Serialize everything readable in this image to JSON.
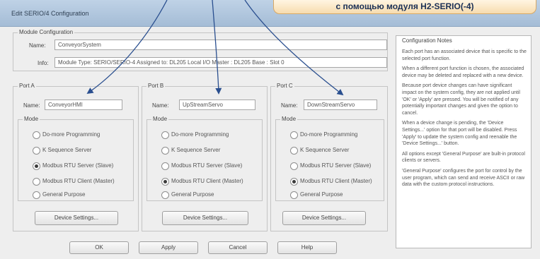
{
  "window": {
    "title": "Edit SERIO/4 Configuration"
  },
  "banner": "с помощью модуля H2-SERIO(-4)",
  "module": {
    "group_label": "Module Configuration",
    "name_label": "Name:",
    "name_value": "ConveyorSystem",
    "info_label": "Info:",
    "info_value": "Module Type: SERIO/SERIO-4   Assigned to: DL205 Local I/O Master : DL205 Base : Slot 0"
  },
  "ports": [
    {
      "title": "Port A",
      "name_label": "Name:",
      "name_value": "ConveyorHMI",
      "mode_label": "Mode",
      "options": [
        "Do-more Programming",
        "K Sequence Server",
        "Modbus RTU Server (Slave)",
        "Modbus RTU Client (Master)",
        "General Purpose"
      ],
      "selected": 2,
      "settings_button": "Device Settings..."
    },
    {
      "title": "Port B",
      "name_label": "Name:",
      "name_value": "UpStreamServo",
      "mode_label": "Mode",
      "options": [
        "Do-more Programming",
        "K Sequence Server",
        "Modbus RTU Server (Slave)",
        "Modbus RTU Client (Master)",
        "General Purpose"
      ],
      "selected": 3,
      "settings_button": "Device Settings..."
    },
    {
      "title": "Port C",
      "name_label": "Name:",
      "name_value": "DownStreamServo",
      "mode_label": "Mode",
      "options": [
        "Do-more Programming",
        "K Sequence Server",
        "Modbus RTU Server (Slave)",
        "Modbus RTU Client (Master)",
        "General Purpose"
      ],
      "selected": 3,
      "settings_button": "Device Settings..."
    }
  ],
  "buttons": {
    "ok": "OK",
    "apply": "Apply",
    "cancel": "Cancel",
    "help": "Help"
  },
  "notes": {
    "title": "Configuration Notes",
    "paragraphs": [
      "Each port has an associated device that is specific to the selected port function.",
      "When a different port function is chosen, the associated device may be deleted and replaced with a new device.",
      "Because port device changes can have significant impact on the system config, they are not applied until 'OK' or 'Apply' are pressed. You will be notified of any potentially important changes and given the option to cancel.",
      "When a device change is pending, the 'Device Settings...' option for that port will be disabled. Press 'Apply' to update the system config and reenable the 'Device Settings...' button.",
      "All options except 'General Purpose' are built-in protocol clients or servers.",
      "'General Purpose' configures the port for control by the user program, which can send and receive ASCII or raw data with the custom protocol instructions."
    ]
  },
  "colors": {
    "annotation_arrow": "#2a4f8f",
    "banner_text": "#1a2f55"
  }
}
